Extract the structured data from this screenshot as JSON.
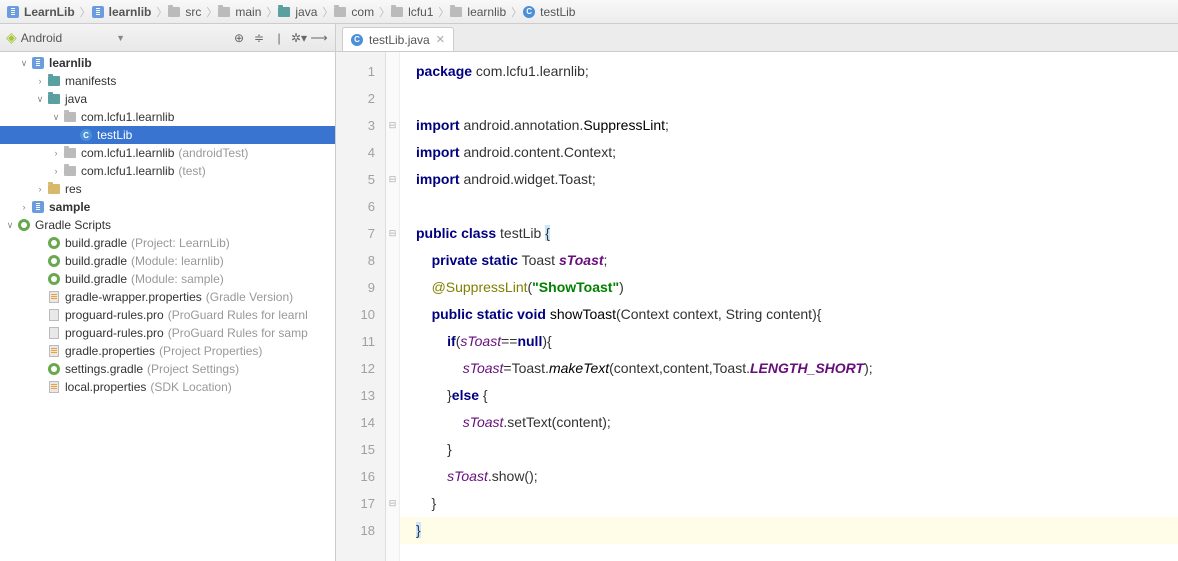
{
  "breadcrumb": [
    "LearnLib",
    "learnlib",
    "src",
    "main",
    "java",
    "com",
    "lcfu1",
    "learnlib",
    "testLib"
  ],
  "sidebar": {
    "title": "Android",
    "items": [
      {
        "type": "module",
        "label": "learnlib",
        "bold": true,
        "arrow": "∨",
        "indent": 1
      },
      {
        "type": "folder",
        "label": "manifests",
        "arrow": "›",
        "indent": 2,
        "folderClass": "teal"
      },
      {
        "type": "folder",
        "label": "java",
        "arrow": "∨",
        "indent": 2,
        "folderClass": "teal"
      },
      {
        "type": "pkg",
        "label": "com.lcfu1.learnlib",
        "arrow": "∨",
        "indent": 3,
        "folderClass": "gray"
      },
      {
        "type": "class",
        "label": "testLib",
        "indent": 4,
        "selected": true
      },
      {
        "type": "pkg",
        "label": "com.lcfu1.learnlib",
        "muted": "(androidTest)",
        "arrow": "›",
        "indent": 3,
        "folderClass": "gray"
      },
      {
        "type": "pkg",
        "label": "com.lcfu1.learnlib",
        "muted": "(test)",
        "arrow": "›",
        "indent": 3,
        "folderClass": "gray"
      },
      {
        "type": "folder",
        "label": "res",
        "arrow": "›",
        "indent": 2,
        "folderClass": ""
      },
      {
        "type": "module",
        "label": "sample",
        "bold": true,
        "arrow": "›",
        "indent": 1
      },
      {
        "type": "gradle-root",
        "label": "Gradle Scripts",
        "arrow": "∨",
        "indent": 0
      },
      {
        "type": "gradle",
        "label": "build.gradle",
        "muted": "(Project: LearnLib)",
        "indent": 2
      },
      {
        "type": "gradle",
        "label": "build.gradle",
        "muted": "(Module: learnlib)",
        "indent": 2
      },
      {
        "type": "gradle",
        "label": "build.gradle",
        "muted": "(Module: sample)",
        "indent": 2
      },
      {
        "type": "props",
        "label": "gradle-wrapper.properties",
        "muted": "(Gradle Version)",
        "indent": 2
      },
      {
        "type": "file",
        "label": "proguard-rules.pro",
        "muted": "(ProGuard Rules for learnl",
        "indent": 2
      },
      {
        "type": "file",
        "label": "proguard-rules.pro",
        "muted": "(ProGuard Rules for samp",
        "indent": 2
      },
      {
        "type": "props",
        "label": "gradle.properties",
        "muted": "(Project Properties)",
        "indent": 2
      },
      {
        "type": "gradle",
        "label": "settings.gradle",
        "muted": "(Project Settings)",
        "indent": 2
      },
      {
        "type": "props",
        "label": "local.properties",
        "muted": "(SDK Location)",
        "indent": 2
      }
    ]
  },
  "tab": {
    "label": "testLib.java"
  },
  "code": {
    "lines": [
      {
        "n": 1,
        "html": "<span class='kw'>package</span> com.lcfu1.learnlib;"
      },
      {
        "n": 2,
        "html": ""
      },
      {
        "n": 3,
        "html": "<span class='kw'>import</span> android.annotation.<span class='cls'>SuppressLint</span>;",
        "fold": "⊟"
      },
      {
        "n": 4,
        "html": "<span class='kw'>import</span> android.content.Context;"
      },
      {
        "n": 5,
        "html": "<span class='kw'>import</span> android.widget.Toast;",
        "fold": "⊟"
      },
      {
        "n": 6,
        "html": ""
      },
      {
        "n": 7,
        "html": "<span class='kw'>public class</span> testLib <span class='hl-brace'>{</span>",
        "fold": "⊟"
      },
      {
        "n": 8,
        "html": "    <span class='kw'>private static</span> Toast <span class='itb'>sToast</span>;"
      },
      {
        "n": 9,
        "html": "    <span class='ann'>@SuppressLint</span>(<span class='str'>\"ShowToast\"</span>)"
      },
      {
        "n": 10,
        "html": "    <span class='kw'>public static void</span> <span class='mth'>showToast</span>(Context context, String content){"
      },
      {
        "n": 11,
        "html": "        <span class='kw'>if</span>(<span class='it'>sToast</span>==<span class='kw'>null</span>){"
      },
      {
        "n": 12,
        "html": "            <span class='it'>sToast</span>=Toast.<span class='fn'>makeText</span>(context,content,Toast.<span class='itb'>LENGTH_SHORT</span>);"
      },
      {
        "n": 13,
        "html": "        }<span class='kw'>else</span> {"
      },
      {
        "n": 14,
        "html": "            <span class='it'>sToast</span>.setText(content);"
      },
      {
        "n": 15,
        "html": "        }"
      },
      {
        "n": 16,
        "html": "        <span class='it'>sToast</span>.show();"
      },
      {
        "n": 17,
        "html": "    }",
        "fold": "⊟"
      },
      {
        "n": 18,
        "html": "<span class='hl-brace'>}</span>",
        "last": true
      }
    ]
  }
}
